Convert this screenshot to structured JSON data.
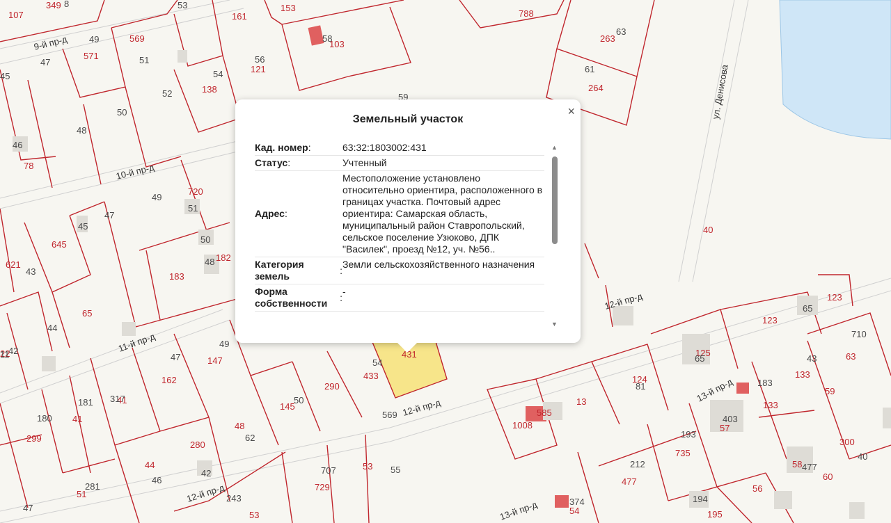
{
  "popup": {
    "title": "Земельный участок",
    "rows": [
      {
        "label": "Кад. номер",
        "value": "63:32:1803002:431"
      },
      {
        "label": "Статус",
        "value": "Учтенный"
      },
      {
        "label": "Адрес",
        "value": "Местоположение установлено относительно ориентира, расположенного в границах участка. Почтовый адрес ориентира: Самарская область, муниципальный район Ставропольский, сельское поселение Узюково, ДПК \"Василек\", проезд №12, уч. №56.."
      },
      {
        "label": "Категория земель",
        "value": "Земли сельскохозяйственного назначения"
      },
      {
        "label": "Форма собственности",
        "value": "-"
      }
    ],
    "close_symbol": "×"
  },
  "map": {
    "streets": [
      "9-й пр-д",
      "10-й пр-д",
      "11-й пр-д",
      "12-й пр-д",
      "12-й пр-д",
      "12-й пр-д",
      "13-й пр-д",
      "13-й пр-д",
      "ул. Денисова"
    ],
    "parcel_numbers": [
      "107",
      "349",
      "8",
      "53",
      "161",
      "153",
      "788",
      "263",
      "63",
      "49",
      "569",
      "571",
      "47",
      "51",
      "56",
      "121",
      "103",
      "58",
      "61",
      "264",
      "45",
      "54",
      "138",
      "52",
      "50",
      "48",
      "59",
      "46",
      "78",
      "720",
      "51",
      "49",
      "47",
      "45",
      "645",
      "50",
      "621",
      "43",
      "48",
      "182",
      "183",
      "40",
      "44",
      "65",
      "123",
      "65",
      "123",
      "49",
      "42",
      "147",
      "47",
      "162",
      "22",
      "11",
      "433",
      "54",
      "431",
      "290",
      "145",
      "50",
      "124",
      "81",
      "125",
      "65",
      "710",
      "63",
      "43",
      "181",
      "41",
      "180",
      "41",
      "317",
      "299",
      "48",
      "62",
      "569",
      "1008",
      "585",
      "13",
      "183",
      "133",
      "133",
      "59",
      "403",
      "57",
      "193",
      "735",
      "300",
      "280",
      "44",
      "46",
      "42",
      "281",
      "51",
      "707",
      "729",
      "53",
      "55",
      "212",
      "477",
      "58",
      "477",
      "60",
      "40",
      "47",
      "243",
      "53",
      "374",
      "54",
      "194",
      "195",
      "56"
    ],
    "colors": {
      "parcel_border": "#c0262d",
      "selected_parcel": "#f7e58a",
      "water": "#cfe6f7",
      "building": "#dedcd6",
      "building_red": "#e06060"
    }
  }
}
